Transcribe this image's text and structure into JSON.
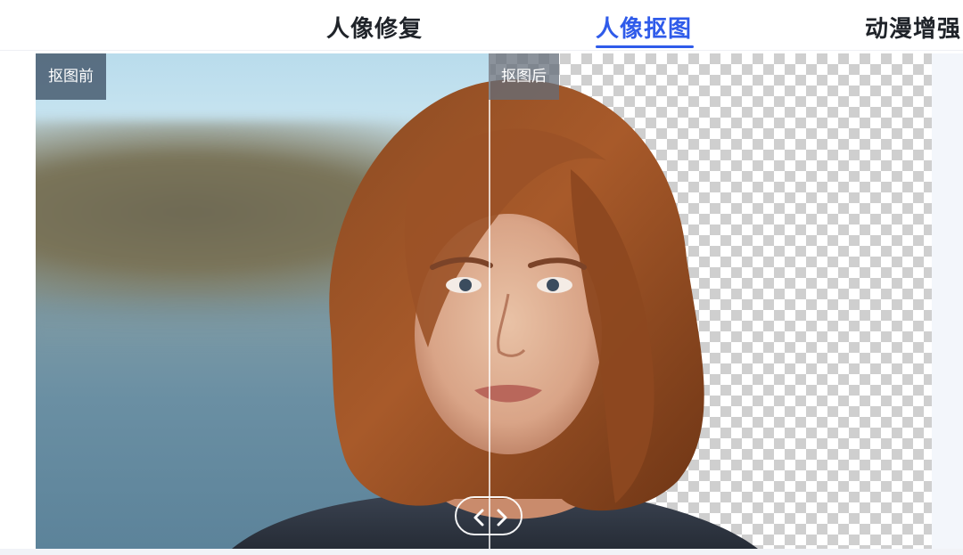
{
  "tabs": [
    {
      "label": "人像修复",
      "active": false
    },
    {
      "label": "人像抠图",
      "active": true
    },
    {
      "label": "动漫增强",
      "active": false
    }
  ],
  "compare": {
    "before_label": "抠图前",
    "after_label": "抠图后",
    "split_fraction": 0.506,
    "handle_icons": [
      "chevron-left-icon",
      "chevron-right-icon"
    ]
  },
  "colors": {
    "accent": "#2f5bea",
    "text": "#1f2329",
    "label_bg": "#485c70",
    "checker": "#cfcfcf"
  }
}
